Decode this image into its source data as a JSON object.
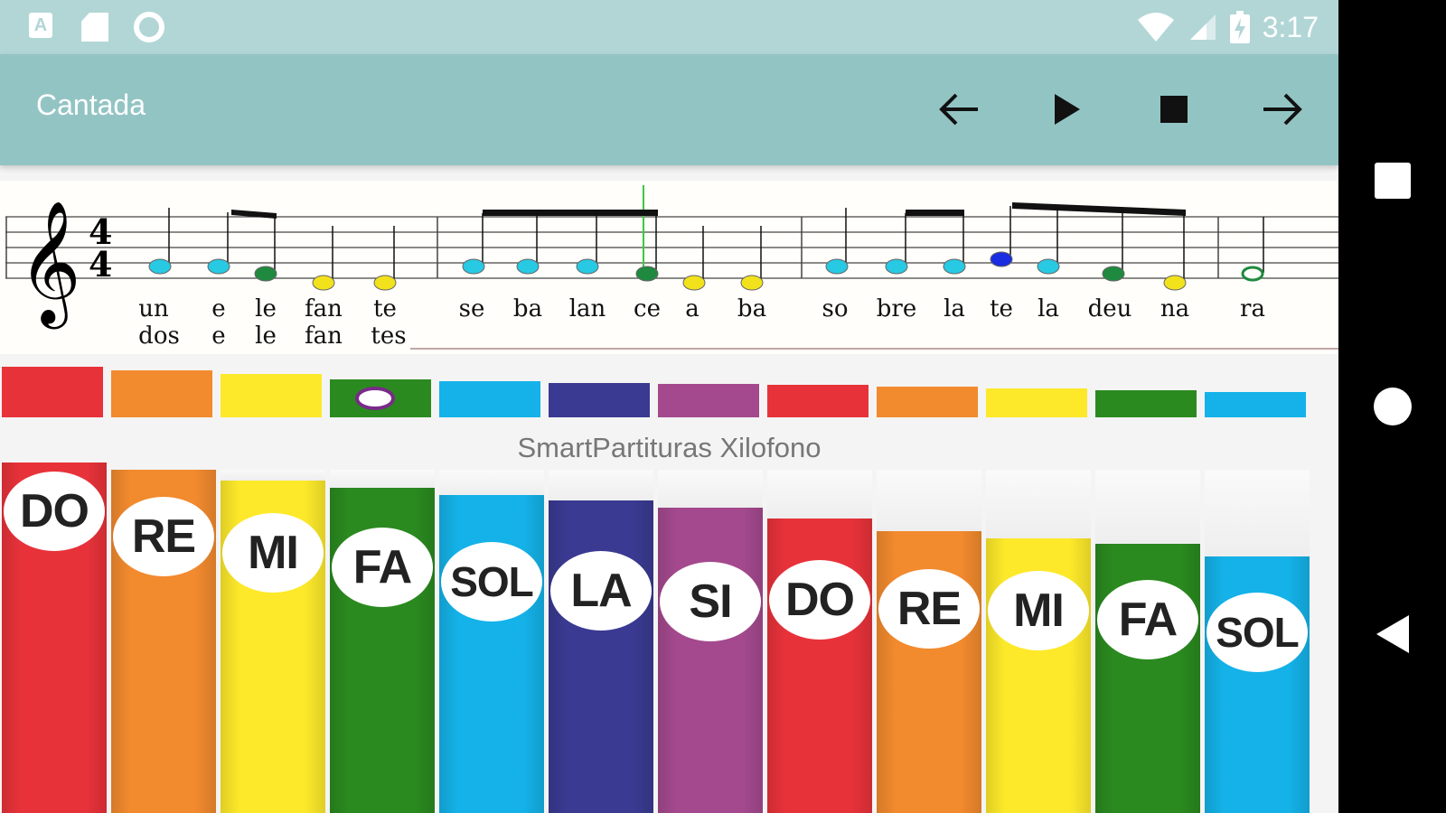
{
  "status_bar": {
    "left_icons": [
      "a-notification-icon",
      "sd-card-icon",
      "circle-notification-icon"
    ],
    "a_label": "A",
    "time": "3:17"
  },
  "toolbar": {
    "title": "Cantada",
    "buttons": [
      "back-arrow-icon",
      "play-icon",
      "stop-icon",
      "forward-arrow-icon"
    ]
  },
  "score": {
    "time_signature_top": "4",
    "time_signature_bottom": "4",
    "lyrics_line1": [
      "un",
      "e",
      "le",
      "fan",
      "te",
      "se",
      "ba",
      "lan",
      "ce",
      "a",
      "ba",
      "so",
      "bre",
      "la",
      "te",
      "la",
      "deu",
      "na",
      "ra"
    ],
    "lyrics_line2": [
      "dos",
      "e",
      "le",
      "fan",
      "tes"
    ]
  },
  "color_bars": {
    "colors": [
      "#e8323a",
      "#f28a2e",
      "#fde92a",
      "#2a8a1f",
      "#14b2e8",
      "#3a3a92",
      "#a4498e",
      "#e8323a",
      "#f28a2e",
      "#fde92a",
      "#2a8a1f",
      "#14b2e8"
    ]
  },
  "brand": "SmartPartituras Xilofono",
  "keys": [
    {
      "label": "DO",
      "color": "#e8323a"
    },
    {
      "label": "RE",
      "color": "#f28a2e"
    },
    {
      "label": "MI",
      "color": "#fde92a"
    },
    {
      "label": "FA",
      "color": "#2a8a1f"
    },
    {
      "label": "SOL",
      "color": "#14b2e8"
    },
    {
      "label": "LA",
      "color": "#3a3a92"
    },
    {
      "label": "SI",
      "color": "#a4498e"
    },
    {
      "label": "DO",
      "color": "#e8323a"
    },
    {
      "label": "RE",
      "color": "#f28a2e"
    },
    {
      "label": "MI",
      "color": "#fde92a"
    },
    {
      "label": "FA",
      "color": "#2a8a1f"
    },
    {
      "label": "SOL",
      "color": "#14b2e8"
    }
  ],
  "nav_bar": [
    "recents-square-icon",
    "home-circle-icon",
    "back-triangle-icon"
  ]
}
